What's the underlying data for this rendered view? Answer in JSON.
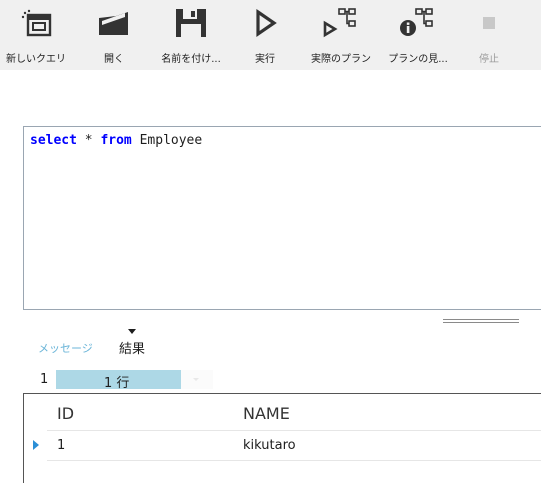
{
  "toolbar": {
    "buttons": [
      {
        "label": "新しいクエリ",
        "icon": "new-query-icon",
        "enabled": true
      },
      {
        "label": "開く",
        "icon": "folder-open-icon",
        "enabled": true
      },
      {
        "label": "名前を付け...",
        "icon": "save-icon",
        "enabled": true
      },
      {
        "label": "実行",
        "icon": "play-icon",
        "enabled": true
      },
      {
        "label": "実際のプラン",
        "icon": "actual-plan-icon",
        "enabled": true
      },
      {
        "label": "プランの見...",
        "icon": "estimated-plan-icon",
        "enabled": true
      },
      {
        "label": "停止",
        "icon": "stop-icon",
        "enabled": false
      }
    ]
  },
  "editor": {
    "tokens": {
      "kw_select": "select",
      "star": " * ",
      "kw_from": "from",
      "table": " Employee"
    }
  },
  "results": {
    "tabs": {
      "messages": "メッセージ",
      "results": "結果"
    },
    "pager": {
      "page": "1",
      "rows": "1 行"
    },
    "columns": [
      "ID",
      "NAME"
    ],
    "rows": [
      {
        "id": "1",
        "name": "kikutaro"
      }
    ]
  },
  "colors": {
    "keyword": "#0000ff",
    "selection": "#add8e6",
    "row_marker": "#2b8fd6",
    "messages_tab": "#6bb5d8"
  }
}
